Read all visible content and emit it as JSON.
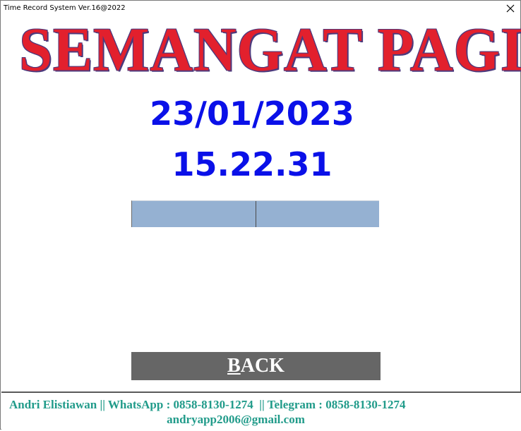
{
  "window": {
    "title": "Time Record System Ver.16@2022",
    "close_icon": "close-icon"
  },
  "greeting": "SEMANGAT PAGI",
  "clock": {
    "date": "23/01/2023",
    "time": "15.22.31"
  },
  "record_grid": {
    "cells": [
      "",
      ""
    ],
    "fill_color": "#95b1d2"
  },
  "back_button": {
    "accel": "B",
    "rest": "ACK"
  },
  "footer": {
    "contact_line": "Andri Elistiawan || WhatsApp : 0858-8130-1274  || Telegram : 0858-8130-1274",
    "email": "andryapp2006@gmail.com"
  },
  "colors": {
    "greeting": "#e2202d",
    "greeting_outline": "#4d3a7d",
    "clock_text": "#0a10e8",
    "button_bg": "#666666",
    "footer_text": "#219b8a"
  }
}
